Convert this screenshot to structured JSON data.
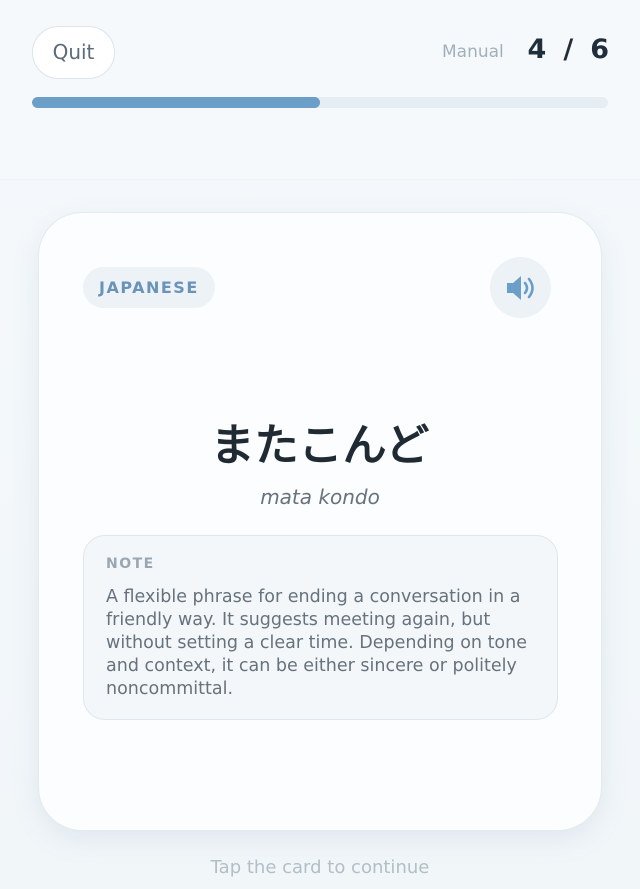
{
  "header": {
    "quit_label": "Quit",
    "mode_label": "Manual",
    "current": "4",
    "separator": "/",
    "total": "6",
    "progress_fraction": 0.5
  },
  "card": {
    "language_badge": "JAPANESE",
    "audio_icon": "speaker-icon",
    "word": "またこんど",
    "romanization": "mata kondo",
    "note": {
      "title": "NOTE",
      "text": "A flexible phrase for ending a conversation in a friendly way. It suggests meeting again, but without setting a clear time. Depending on tone and context, it can be either sincere or politely noncommittal."
    }
  },
  "footer": {
    "hint": "Tap the card to continue"
  },
  "colors": {
    "accent": "#6b9fc8",
    "text_dark": "#1f2a33",
    "muted": "#a3b0bb"
  }
}
